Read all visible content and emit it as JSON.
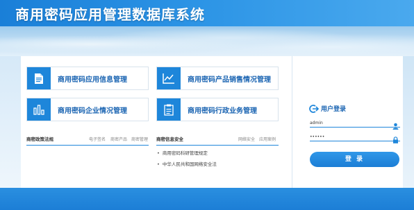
{
  "header": {
    "title": "商用密码应用管理数据库系统"
  },
  "modules": [
    {
      "label": "商用密码应用信息管理",
      "icon": "document-icon"
    },
    {
      "label": "商用密码产品销售情况管理",
      "icon": "line-chart-icon"
    },
    {
      "label": "商用密码企业情况管理",
      "icon": "bar-chart-icon"
    },
    {
      "label": "商用密码行政业务管理",
      "icon": "clipboard-icon"
    }
  ],
  "policy_section": {
    "title": "商密政策法规",
    "tabs": [
      "电子签名",
      "商密产品",
      "商密管理"
    ]
  },
  "security_section": {
    "title": "商密信息安全",
    "tabs": [
      "网络安全",
      "应用案例"
    ],
    "items": [
      "商用密码科研管理规定",
      "中华人民共和国网络安全法"
    ]
  },
  "login": {
    "title": "用户登录",
    "username_value": "admin",
    "password_value": "••••••",
    "button_label": "登 录"
  },
  "colors": {
    "accent": "#1e86da",
    "link_text": "#1a64b2"
  }
}
